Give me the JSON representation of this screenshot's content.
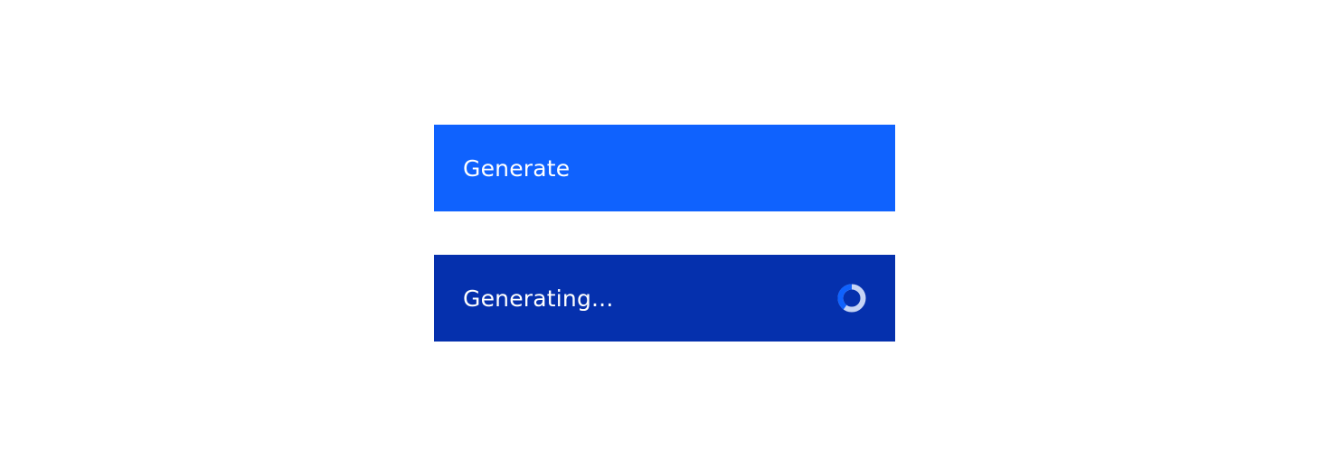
{
  "buttons": {
    "generate": {
      "label": "Generate",
      "background": "#0f62fe",
      "state": "default"
    },
    "generating": {
      "label": "Generating...",
      "background": "#0530ad",
      "state": "loading",
      "icon": "loading-spinner-icon"
    }
  },
  "colors": {
    "page_background": "#ffffff",
    "text": "#ffffff",
    "spinner_track": "#c6d4f5",
    "spinner_progress": "#0f62fe"
  }
}
